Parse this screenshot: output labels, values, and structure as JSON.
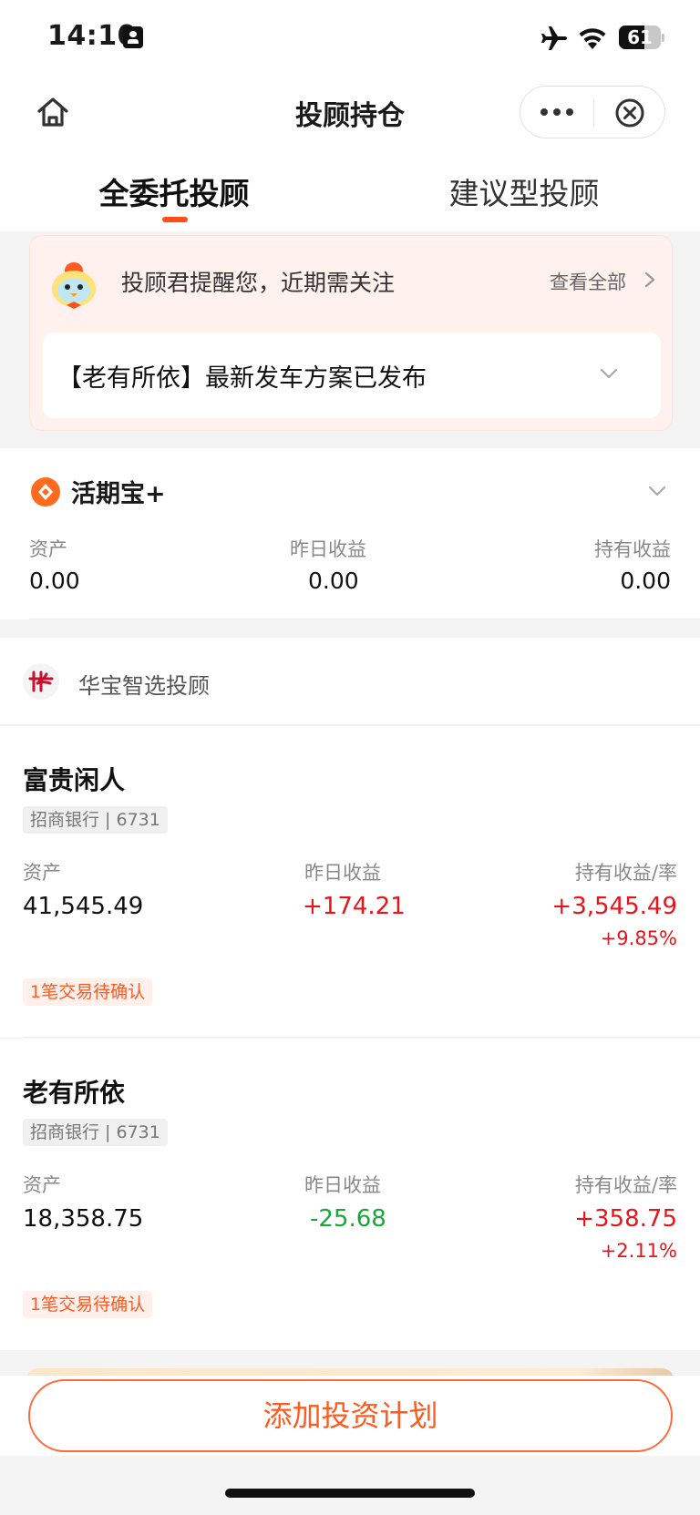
{
  "status_bar": {
    "time": "14:10",
    "battery": 61
  },
  "nav": {
    "title": "投顾持仓"
  },
  "tabs": [
    {
      "label": "全委托投顾",
      "active": true
    },
    {
      "label": "建议型投顾",
      "active": false
    }
  ],
  "notice": {
    "text": "投顾君提醒您，近期需关注",
    "view_all": "查看全部",
    "item": "【老有所依】最新发车方案已发布"
  },
  "huoqi": {
    "name": "活期宝+",
    "labels": [
      "资产",
      "昨日收益",
      "持有收益"
    ],
    "values": [
      "0.00",
      "0.00",
      "0.00"
    ]
  },
  "advisor": {
    "name": "华宝智选投顾"
  },
  "portfolios": [
    {
      "name": "富贵闲人",
      "tag": "招商银行 | 6731",
      "labels": [
        "资产",
        "昨日收益",
        "持有收益/率"
      ],
      "asset": "41,545.49",
      "yesterday": "+174.21",
      "holding": "+3,545.49",
      "rate": "+9.85%",
      "pending": "1笔交易待确认"
    },
    {
      "name": "老有所依",
      "tag": "招商银行 | 6731",
      "labels": [
        "资产",
        "昨日收益",
        "持有收益/率"
      ],
      "asset": "18,358.75",
      "yesterday": "-25.68",
      "holding": "+358.75",
      "rate": "+2.11%",
      "pending": "1笔交易待确认"
    }
  ],
  "footer": {
    "add_button": "添加投资计划"
  },
  "colors": {
    "accent": "#ff5a1f",
    "gain": "#e8141b",
    "loss": "#18a83a"
  },
  "icons": [
    "id-card-icon",
    "airplane-icon",
    "wifi-icon",
    "battery-icon",
    "home-icon",
    "more-icon",
    "close-icon",
    "mascot-icon",
    "chevron-right-icon",
    "chevron-down-icon",
    "huoqibao-logo-icon",
    "huabao-logo-icon"
  ]
}
